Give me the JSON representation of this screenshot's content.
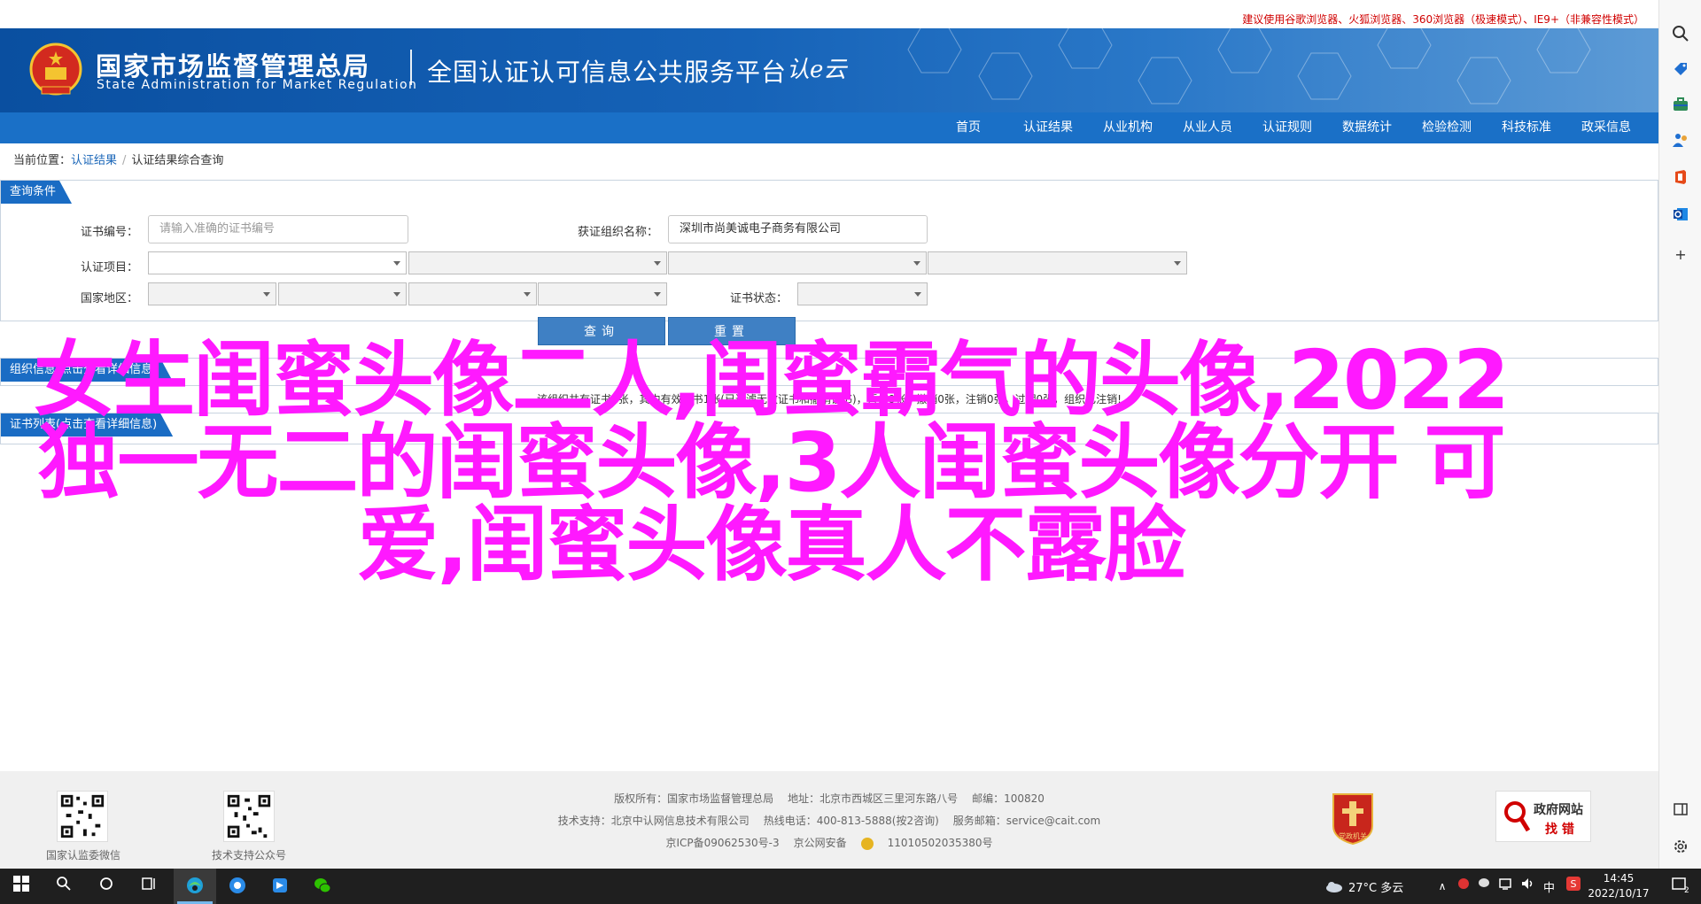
{
  "header": {
    "browser_note": "建议使用谷歌浏览器、火狐浏览器、360浏览器（极速模式）、IE9+（非兼容性模式）",
    "org_name_cn": "国家市场监督管理总局",
    "org_name_en": "State Administration  for  Market Regulation",
    "platform_title": "全国认证认可信息公共服务平台",
    "cert_logo_text": "认e云"
  },
  "nav": {
    "items": [
      "首页",
      "认证结果",
      "从业机构",
      "从业人员",
      "认证规则",
      "数据统计",
      "检验检测",
      "科技标准",
      "政采信息"
    ]
  },
  "breadcrumb": {
    "prefix": "当前位置：",
    "items": [
      "认证结果",
      "认证结果综合查询"
    ]
  },
  "query": {
    "tab_label": "查询条件",
    "cert_no_label": "证书编号：",
    "cert_no_placeholder": "请输入准确的证书编号",
    "org_label": "获证组织名称：",
    "org_value": "深圳市尚美诚电子商务有限公司",
    "item_label": "认证项目：",
    "region_label": "国家地区：",
    "status_label": "证书状态：",
    "search_btn": "查询",
    "reset_btn": "重置"
  },
  "summary": {
    "tab_label": "组织信息(点击查看详细信息)",
    "note": "该组织共有证书1张，其中有效证书1张(已过滤无效证书和撤销证书)，暂停0张，撤销0张，注销0张，过期0张，组织已注销!"
  },
  "list": {
    "tab_label": "证书列表(点击查看详细信息)"
  },
  "overlay_title": "女生闺蜜头像二人,闺蜜霸气的头像,2022独一无二的闺蜜头像,3人闺蜜头像分开 可爱,闺蜜头像真人不露脸",
  "footer": {
    "qr1_label": "国家认监委微信",
    "qr2_label": "技术支持公众号",
    "line1": [
      "版权所有：国家市场监督管理总局",
      "地址：北京市西城区三里河东路八号",
      "邮编：100820"
    ],
    "line2": [
      "技术支持：北京中认网信息技术有限公司",
      "热线电话：400-813-5888(按2咨询)",
      "服务邮箱：service@cait.com"
    ],
    "icp": "京ICP备09062530号-3",
    "police": "京公网安备",
    "police_no": "11010502035380号",
    "gov_find_1": "政府网站",
    "gov_find_2": "找 错",
    "gov_badge": "党政机关"
  },
  "taskbar": {
    "weather": "27°C  多云",
    "ime": "中",
    "time": "14:45",
    "date": "2022/10/17",
    "notify_count": "2"
  },
  "colors": {
    "header_blue": "#0a4fa0",
    "nav_blue": "#1a70c7",
    "overlay_magenta": "#ff19ff",
    "button_blue": "#3f80c4"
  }
}
